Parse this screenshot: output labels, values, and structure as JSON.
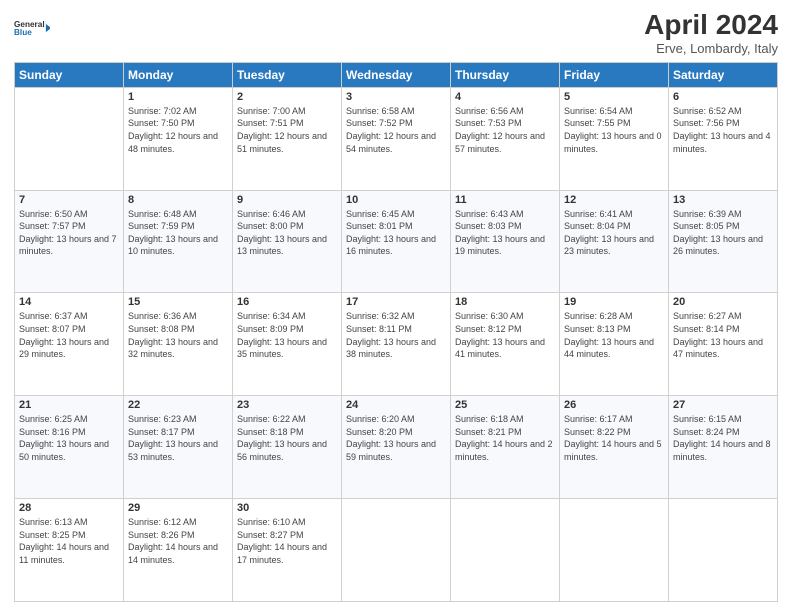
{
  "header": {
    "logo_line1": "General",
    "logo_line2": "Blue",
    "month_title": "April 2024",
    "subtitle": "Erve, Lombardy, Italy"
  },
  "weekdays": [
    "Sunday",
    "Monday",
    "Tuesday",
    "Wednesday",
    "Thursday",
    "Friday",
    "Saturday"
  ],
  "weeks": [
    [
      {
        "day": null
      },
      {
        "day": "1",
        "sunrise": "7:02 AM",
        "sunset": "7:50 PM",
        "daylight": "12 hours and 48 minutes."
      },
      {
        "day": "2",
        "sunrise": "7:00 AM",
        "sunset": "7:51 PM",
        "daylight": "12 hours and 51 minutes."
      },
      {
        "day": "3",
        "sunrise": "6:58 AM",
        "sunset": "7:52 PM",
        "daylight": "12 hours and 54 minutes."
      },
      {
        "day": "4",
        "sunrise": "6:56 AM",
        "sunset": "7:53 PM",
        "daylight": "12 hours and 57 minutes."
      },
      {
        "day": "5",
        "sunrise": "6:54 AM",
        "sunset": "7:55 PM",
        "daylight": "13 hours and 0 minutes."
      },
      {
        "day": "6",
        "sunrise": "6:52 AM",
        "sunset": "7:56 PM",
        "daylight": "13 hours and 4 minutes."
      }
    ],
    [
      {
        "day": "7",
        "sunrise": "6:50 AM",
        "sunset": "7:57 PM",
        "daylight": "13 hours and 7 minutes."
      },
      {
        "day": "8",
        "sunrise": "6:48 AM",
        "sunset": "7:59 PM",
        "daylight": "13 hours and 10 minutes."
      },
      {
        "day": "9",
        "sunrise": "6:46 AM",
        "sunset": "8:00 PM",
        "daylight": "13 hours and 13 minutes."
      },
      {
        "day": "10",
        "sunrise": "6:45 AM",
        "sunset": "8:01 PM",
        "daylight": "13 hours and 16 minutes."
      },
      {
        "day": "11",
        "sunrise": "6:43 AM",
        "sunset": "8:03 PM",
        "daylight": "13 hours and 19 minutes."
      },
      {
        "day": "12",
        "sunrise": "6:41 AM",
        "sunset": "8:04 PM",
        "daylight": "13 hours and 23 minutes."
      },
      {
        "day": "13",
        "sunrise": "6:39 AM",
        "sunset": "8:05 PM",
        "daylight": "13 hours and 26 minutes."
      }
    ],
    [
      {
        "day": "14",
        "sunrise": "6:37 AM",
        "sunset": "8:07 PM",
        "daylight": "13 hours and 29 minutes."
      },
      {
        "day": "15",
        "sunrise": "6:36 AM",
        "sunset": "8:08 PM",
        "daylight": "13 hours and 32 minutes."
      },
      {
        "day": "16",
        "sunrise": "6:34 AM",
        "sunset": "8:09 PM",
        "daylight": "13 hours and 35 minutes."
      },
      {
        "day": "17",
        "sunrise": "6:32 AM",
        "sunset": "8:11 PM",
        "daylight": "13 hours and 38 minutes."
      },
      {
        "day": "18",
        "sunrise": "6:30 AM",
        "sunset": "8:12 PM",
        "daylight": "13 hours and 41 minutes."
      },
      {
        "day": "19",
        "sunrise": "6:28 AM",
        "sunset": "8:13 PM",
        "daylight": "13 hours and 44 minutes."
      },
      {
        "day": "20",
        "sunrise": "6:27 AM",
        "sunset": "8:14 PM",
        "daylight": "13 hours and 47 minutes."
      }
    ],
    [
      {
        "day": "21",
        "sunrise": "6:25 AM",
        "sunset": "8:16 PM",
        "daylight": "13 hours and 50 minutes."
      },
      {
        "day": "22",
        "sunrise": "6:23 AM",
        "sunset": "8:17 PM",
        "daylight": "13 hours and 53 minutes."
      },
      {
        "day": "23",
        "sunrise": "6:22 AM",
        "sunset": "8:18 PM",
        "daylight": "13 hours and 56 minutes."
      },
      {
        "day": "24",
        "sunrise": "6:20 AM",
        "sunset": "8:20 PM",
        "daylight": "13 hours and 59 minutes."
      },
      {
        "day": "25",
        "sunrise": "6:18 AM",
        "sunset": "8:21 PM",
        "daylight": "14 hours and 2 minutes."
      },
      {
        "day": "26",
        "sunrise": "6:17 AM",
        "sunset": "8:22 PM",
        "daylight": "14 hours and 5 minutes."
      },
      {
        "day": "27",
        "sunrise": "6:15 AM",
        "sunset": "8:24 PM",
        "daylight": "14 hours and 8 minutes."
      }
    ],
    [
      {
        "day": "28",
        "sunrise": "6:13 AM",
        "sunset": "8:25 PM",
        "daylight": "14 hours and 11 minutes."
      },
      {
        "day": "29",
        "sunrise": "6:12 AM",
        "sunset": "8:26 PM",
        "daylight": "14 hours and 14 minutes."
      },
      {
        "day": "30",
        "sunrise": "6:10 AM",
        "sunset": "8:27 PM",
        "daylight": "14 hours and 17 minutes."
      },
      {
        "day": null
      },
      {
        "day": null
      },
      {
        "day": null
      },
      {
        "day": null
      }
    ]
  ]
}
